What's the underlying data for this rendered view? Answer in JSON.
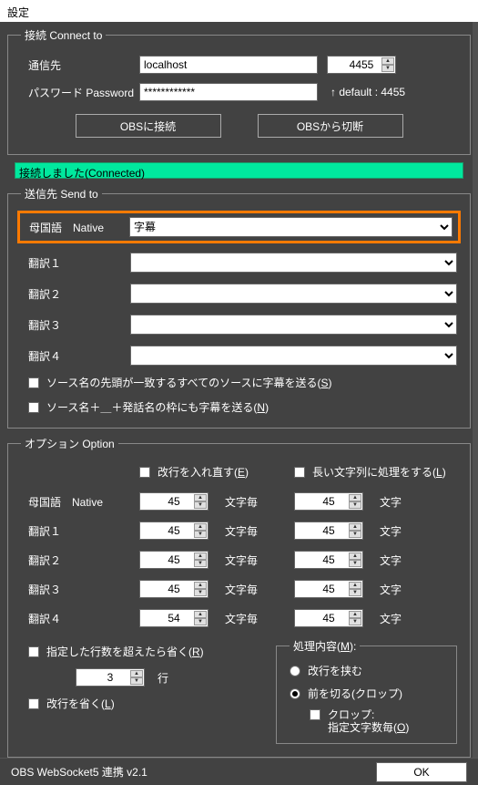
{
  "window": {
    "title": "設定"
  },
  "connect": {
    "legend": "接続 Connect to",
    "host_label": "通信先",
    "host_value": "localhost",
    "port_value": "4455",
    "password_label": "パスワード Password",
    "password_value": "************",
    "default_hint": "↑ default : 4455",
    "btn_connect": "OBSに接続",
    "btn_disconnect": "OBSから切断"
  },
  "status": {
    "text": "接続しました(Connected)"
  },
  "sendto": {
    "legend": "送信先 Send to",
    "native_label": "母国語　Native",
    "native_value": "字幕",
    "t1_label": "翻訳１",
    "t2_label": "翻訳２",
    "t3_label": "翻訳３",
    "t4_label": "翻訳４",
    "chk_prefix_label_a": "ソース名の先頭が一致するすべてのソースに字幕を送る(",
    "chk_prefix_key": "S",
    "chk_prefix_label_b": ")",
    "chk_speaker_label_a": "ソース名＋＿＋発話名の枠にも字幕を送る(",
    "chk_speaker_key": "N",
    "chk_speaker_label_b": ")"
  },
  "option": {
    "legend": "オプション Option",
    "reinsert_label_a": "改行を入れ直す(",
    "reinsert_key": "E",
    "reinsert_label_b": ")",
    "longproc_label_a": "長い文字列に処理をする(",
    "longproc_key": "L",
    "longproc_label_b": ")",
    "rows": {
      "native": {
        "label": "母国語　Native",
        "v1": "45",
        "u1": "文字毎",
        "v2": "45",
        "u2": "文字"
      },
      "t1": {
        "label": "翻訳１",
        "v1": "45",
        "u1": "文字毎",
        "v2": "45",
        "u2": "文字"
      },
      "t2": {
        "label": "翻訳２",
        "v1": "45",
        "u1": "文字毎",
        "v2": "45",
        "u2": "文字"
      },
      "t3": {
        "label": "翻訳３",
        "v1": "45",
        "u1": "文字毎",
        "v2": "45",
        "u2": "文字"
      },
      "t4": {
        "label": "翻訳４",
        "v1": "54",
        "u1": "文字毎",
        "v2": "45",
        "u2": "文字"
      }
    },
    "omit_over_label_a": "指定した行数を超えたら省く(",
    "omit_over_key": "R",
    "omit_over_label_b": ")",
    "lines_value": "3",
    "lines_unit": "行",
    "omit_lf_label_a": "改行を省く(",
    "omit_lf_key": "L",
    "omit_lf_label_b": ")",
    "proc": {
      "legend_a": "処理内容(",
      "legend_key": "M",
      "legend_b": "):",
      "radio_insert": "改行を挟む",
      "radio_crop": "前を切る(クロップ)",
      "crop_sub_a": "クロップ:",
      "crop_sub_b_a": "指定文字数毎(",
      "crop_sub_b_key": "O",
      "crop_sub_b_b": ")"
    }
  },
  "footer": {
    "version": "OBS WebSocket5 連携 v2.1",
    "ok": "OK"
  }
}
